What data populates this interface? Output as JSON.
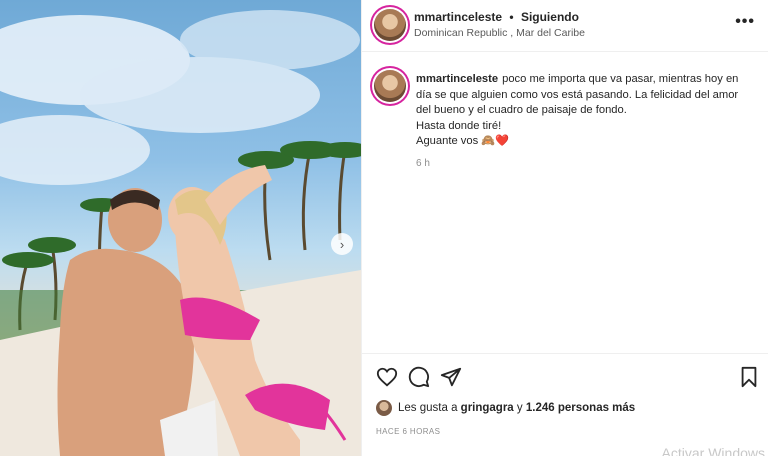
{
  "post": {
    "image_alt": "",
    "header": {
      "username": "mmartinceleste",
      "separator": "•",
      "follow_status": "Siguiendo",
      "location": "Dominican Republic , Mar del Caribe",
      "more_icon": "more-horizontal-icon"
    },
    "caption": {
      "username": "mmartinceleste",
      "line1": "poco me importa que va pasar, mientras hoy en",
      "line2": "día se que alguien como vos está pasando. La felicidad del amor",
      "line3": "del bueno y el cuadro de paisaje de fondo.",
      "line4": "Hasta donde tiré!",
      "line5": "Aguante vos 🙈❤️",
      "time_ago": "6 h"
    },
    "actions": {
      "like_icon": "heart-icon",
      "comment_icon": "comment-icon",
      "share_icon": "share-icon",
      "save_icon": "bookmark-icon"
    },
    "likes": {
      "prefix": "Les gusta a",
      "user": "gringagra",
      "middle": "y",
      "count": "1.246 personas más"
    },
    "posted_at": "HACE 6 HORAS",
    "next_icon": "chevron-right-icon"
  },
  "overlay": {
    "watermark": "Activar Windows"
  }
}
